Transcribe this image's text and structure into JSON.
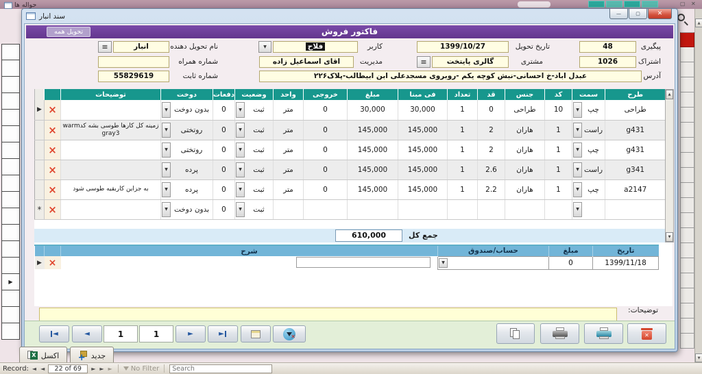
{
  "colors": {
    "banner_purple": "#6a3c96",
    "table_header_teal": "#17978d",
    "payments_header_blue": "#72b5d8",
    "delete_red": "#e0462e",
    "close_button_red": "#d4533f"
  },
  "background": {
    "tab_title": "حواله ها",
    "excel_button_label": "اکسل",
    "new_button_label": "جدید",
    "status": {
      "record_label": "Record:",
      "position": "22 of 69",
      "no_filter_label": "No Filter",
      "search_placeholder": "Search"
    }
  },
  "window": {
    "title": "سند انبار",
    "banner": {
      "title": "فاکتور فروش",
      "deliver_all": "تحویل همه"
    },
    "header_fields": {
      "peygiri": {
        "label": "پیگیری",
        "value": "48"
      },
      "tahvil_date": {
        "label": "تاریخ تحویل",
        "value": "1399/10/27"
      },
      "user": {
        "label": "کاربر",
        "value": "فلاح"
      },
      "deliverer": {
        "label": "نام تحویل دهنده",
        "value": "انبار"
      },
      "eshterak": {
        "label": "اشتراک",
        "value": "1026"
      },
      "customer": {
        "label": "مشتری",
        "value": "گالری پایتخت"
      },
      "management": {
        "label": "مدیریت",
        "value": "اقای اسماعیل زاده"
      },
      "mobile": {
        "label": "شماره همراه",
        "value": ""
      },
      "address": {
        "label": "آدرس",
        "value": "عبدل اباد-خ احسانی-نبش کوچه یکم -روبروی مسجدعلی ابن ابیطالب-پلاک۲۲۶"
      },
      "phone": {
        "label": "شماره ثابت",
        "value": "55829619"
      }
    },
    "items_table": {
      "columns": [
        "طرح",
        "سمت",
        "کد",
        "جنس",
        "قد",
        "تعداد",
        "فی مبنا",
        "مبلغ",
        "خروجی",
        "واحد",
        "وضعیت",
        "دفعات",
        "دوخت",
        "توضیحات"
      ],
      "rows": [
        {
          "selector": "▶",
          "cells": [
            "طراحی",
            "چپ",
            "10",
            "طراحی",
            "0",
            "1",
            "30,000",
            "30,000",
            "0",
            "متر",
            "ثبت",
            "0",
            "بدون دوخت",
            ""
          ]
        },
        {
          "selector": "",
          "cells": [
            "g431",
            "راست",
            "1",
            "هاران",
            "2",
            "1",
            "145,000",
            "145,000",
            "0",
            "متر",
            "ثبت",
            "0",
            "روتختی",
            "زمینه کل کارها طوسی بشه کدwarm gray3"
          ]
        },
        {
          "selector": "",
          "cells": [
            "g431",
            "چپ",
            "1",
            "هاران",
            "2",
            "1",
            "145,000",
            "145,000",
            "0",
            "متر",
            "ثبت",
            "0",
            "روتختی",
            ""
          ]
        },
        {
          "selector": "",
          "cells": [
            "g341",
            "راست",
            "1",
            "هاران",
            "2.6",
            "1",
            "145,000",
            "145,000",
            "0",
            "متر",
            "ثبت",
            "0",
            "پرده",
            ""
          ]
        },
        {
          "selector": "",
          "cells": [
            "a2147",
            "چپ",
            "1",
            "هاران",
            "2.2",
            "1",
            "145,000",
            "145,000",
            "0",
            "متر",
            "ثبت",
            "0",
            "پرده",
            "به جزاین کاربقیه طوسی شود"
          ]
        },
        {
          "selector": "*",
          "cells": [
            "",
            "",
            "",
            "",
            "",
            "",
            "",
            "",
            "",
            "",
            "ثبت",
            "0",
            "بدون دوخت",
            ""
          ]
        }
      ]
    },
    "total": {
      "label": "جمع کل",
      "value": "610,000"
    },
    "payments_table": {
      "columns": [
        "تاریخ",
        "مبلغ",
        "حساب/صندوق",
        "شرح"
      ],
      "row": {
        "selector": "▶",
        "date": "1399/11/18",
        "amount": "0",
        "account": "",
        "description": ""
      }
    },
    "notes": {
      "label": "توضیحات:",
      "value": ""
    },
    "record_nav": {
      "page_a": "1",
      "page_b": "1"
    }
  }
}
